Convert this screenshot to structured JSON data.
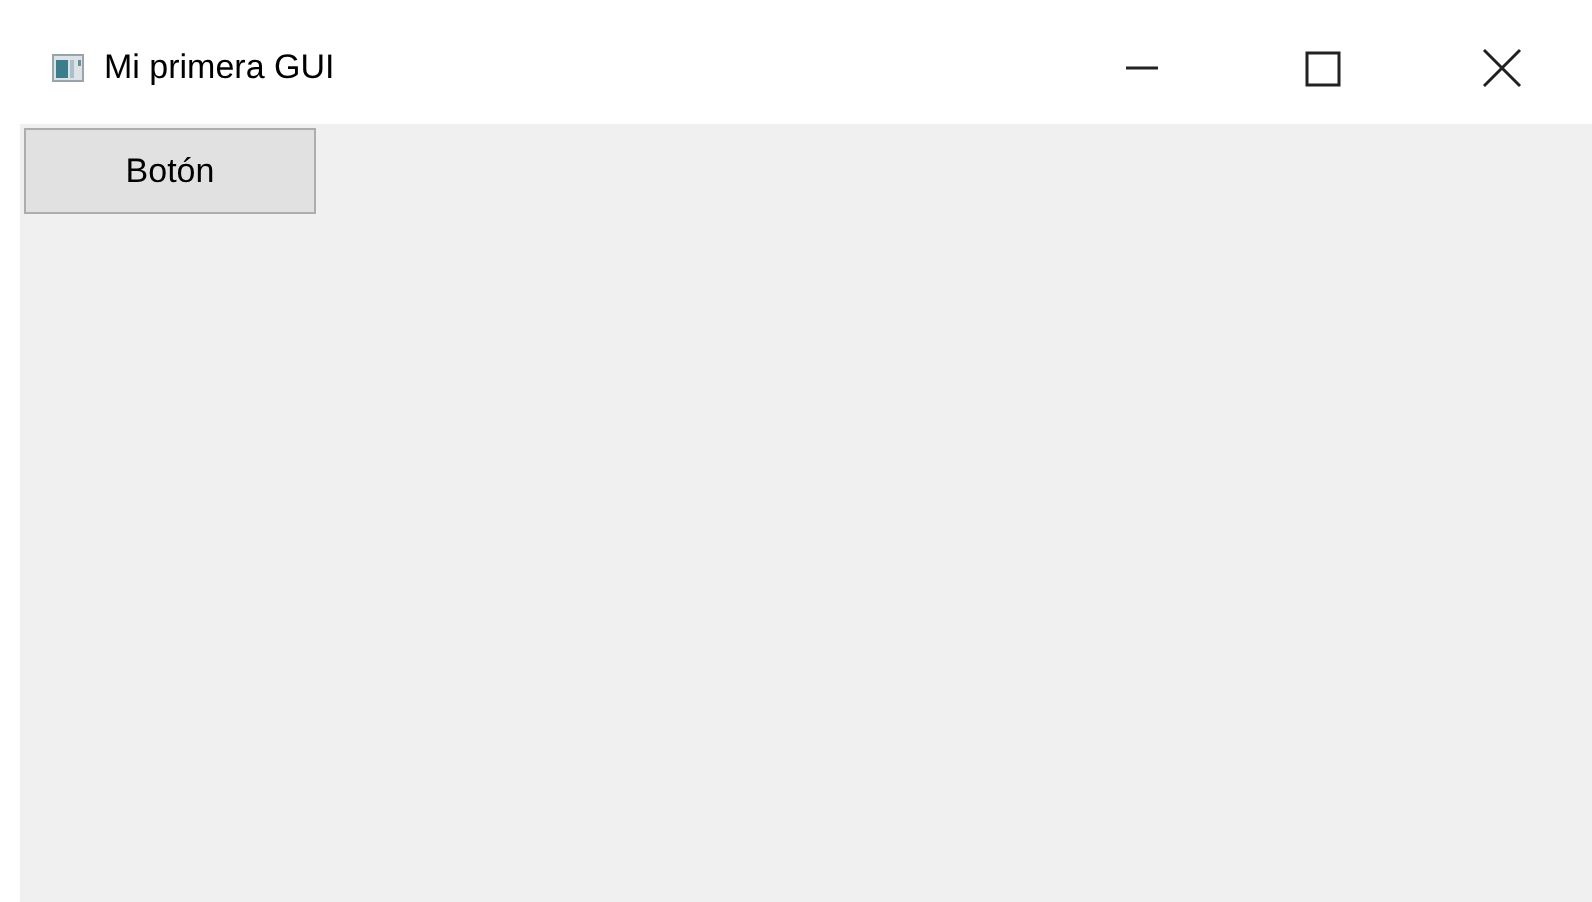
{
  "window": {
    "title": "Mi primera GUI"
  },
  "buttons": [
    {
      "label": "Botón"
    }
  ]
}
